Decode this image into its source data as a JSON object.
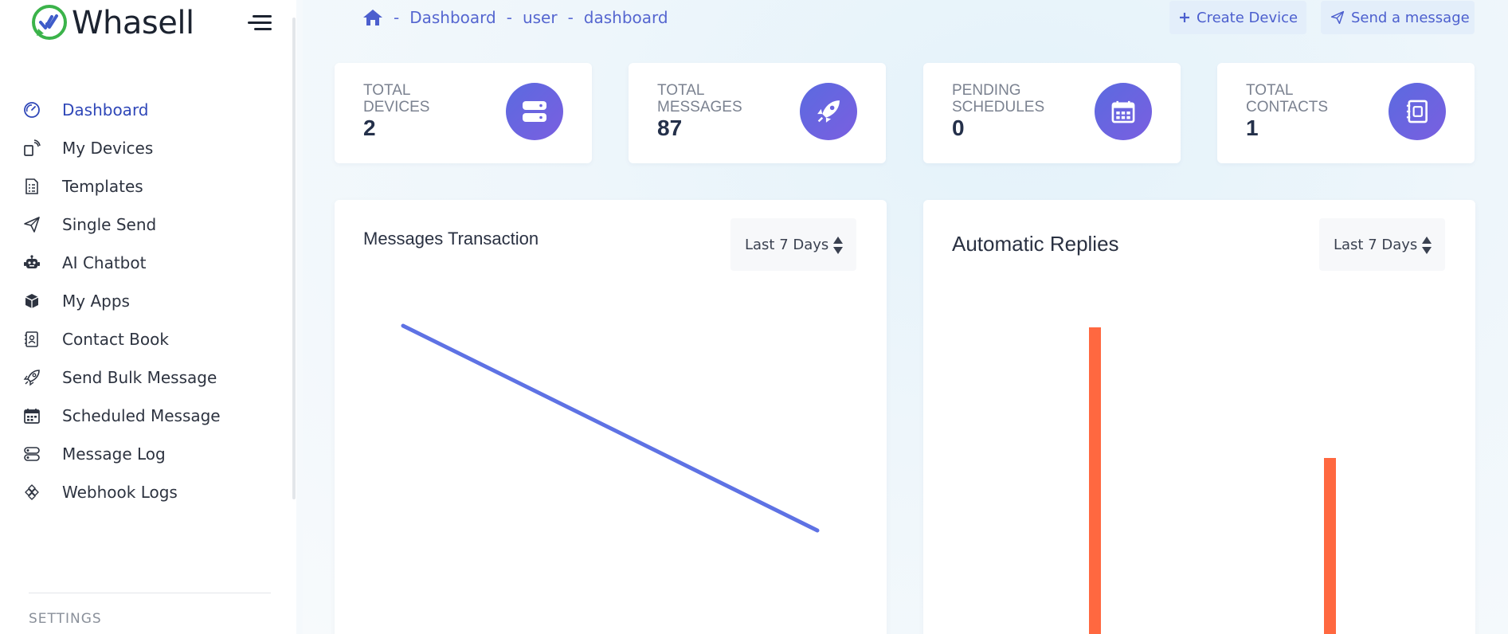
{
  "app": {
    "brand": "Whasell"
  },
  "sidebar": {
    "items": [
      {
        "label": "Dashboard",
        "icon": "dashboard-gauge-icon",
        "active": true
      },
      {
        "label": "My Devices",
        "icon": "devices-icon"
      },
      {
        "label": "Templates",
        "icon": "template-file-icon"
      },
      {
        "label": "Single Send",
        "icon": "paper-plane-icon"
      },
      {
        "label": "AI Chatbot",
        "icon": "robot-icon"
      },
      {
        "label": "My Apps",
        "icon": "cube-icon"
      },
      {
        "label": "Contact Book",
        "icon": "contact-book-icon"
      },
      {
        "label": "Send Bulk Message",
        "icon": "rocket-icon"
      },
      {
        "label": "Scheduled Message",
        "icon": "calendar-icon"
      },
      {
        "label": "Message Log",
        "icon": "log-icon"
      },
      {
        "label": "Webhook Logs",
        "icon": "webhook-icon"
      }
    ],
    "settings_heading": "SETTINGS"
  },
  "breadcrumb": [
    "Dashboard",
    "user",
    "dashboard"
  ],
  "header": {
    "create_device": "Create Device",
    "send_message": "Send a message"
  },
  "stats": [
    {
      "label_line1": "TOTAL",
      "label_line2": "DEVICES",
      "value": "2",
      "icon": "server-icon"
    },
    {
      "label_line1": "TOTAL",
      "label_line2": "MESSAGES",
      "value": "87",
      "icon": "rocket-icon"
    },
    {
      "label_line1": "PENDING",
      "label_line2": "SCHEDULES",
      "value": "0",
      "icon": "calendar-icon"
    },
    {
      "label_line1": "TOTAL",
      "label_line2": "CONTACTS",
      "value": "1",
      "icon": "contact-book-icon"
    }
  ],
  "panels": {
    "messages": {
      "title": "Messages Transaction",
      "range": "Last 7 Days"
    },
    "replies": {
      "title": "Automatic Replies",
      "range": "Last 7 Days"
    }
  },
  "colors": {
    "accent": "#5566d0",
    "line": "#5e72e4",
    "bar": "#ff6840",
    "icon_gradient_start": "#5b6ae0",
    "icon_gradient_end": "#7a5fe0"
  },
  "chart_data": [
    {
      "type": "line",
      "title": "Messages Transaction",
      "series": [
        {
          "values": [
            1.0,
            0.0
          ]
        }
      ],
      "note_visible_portion_only": true
    },
    {
      "type": "bar",
      "title": "Automatic Replies",
      "series": [
        {
          "values": [
            1.0,
            0.59
          ]
        }
      ],
      "ylim": [
        0,
        1
      ]
    }
  ]
}
